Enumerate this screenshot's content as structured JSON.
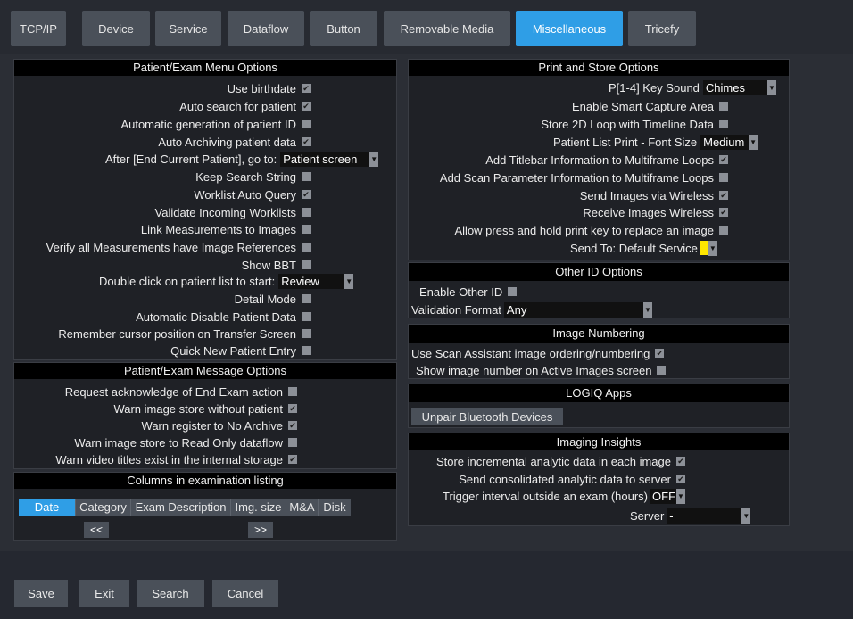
{
  "tabs": [
    "TCP/IP",
    "Device",
    "Service",
    "Dataflow",
    "Button",
    "Removable Media",
    "Miscellaneous",
    "Tricefy"
  ],
  "active_tab": "Miscellaneous",
  "patient_exam_menu": {
    "title": "Patient/Exam Menu Options",
    "use_birthdate": {
      "label": "Use birthdate",
      "checked": true
    },
    "auto_search": {
      "label": "Auto search for patient",
      "checked": true
    },
    "auto_gen_id": {
      "label": "Automatic generation of patient ID",
      "checked": false
    },
    "auto_archiving": {
      "label": "Auto Archiving patient data",
      "checked": true
    },
    "after_end": {
      "label": "After [End Current Patient], go to:",
      "value": "Patient screen"
    },
    "keep_search": {
      "label": "Keep Search String",
      "checked": false
    },
    "worklist_auto": {
      "label": "Worklist Auto Query",
      "checked": true
    },
    "validate_worklists": {
      "label": "Validate Incoming Worklists",
      "checked": false
    },
    "link_measurements": {
      "label": "Link Measurements to Images",
      "checked": false
    },
    "verify_measurements": {
      "label": "Verify all Measurements have Image References",
      "checked": false
    },
    "show_bbt": {
      "label": "Show BBT",
      "checked": false
    },
    "double_click": {
      "label": "Double click on patient list to start:",
      "value": "Review"
    },
    "detail_mode": {
      "label": "Detail Mode",
      "checked": false
    },
    "auto_disable": {
      "label": "Automatic Disable Patient Data",
      "checked": false
    },
    "remember_cursor": {
      "label": "Remember cursor position on Transfer Screen",
      "checked": false
    },
    "quick_new": {
      "label": "Quick New Patient Entry",
      "checked": false
    }
  },
  "patient_exam_message": {
    "title": "Patient/Exam Message Options",
    "request_ack": {
      "label": "Request acknowledge of End Exam action",
      "checked": false
    },
    "warn_store": {
      "label": "Warn image store without patient",
      "checked": true
    },
    "warn_register": {
      "label": "Warn register to No Archive",
      "checked": true
    },
    "warn_readonly": {
      "label": "Warn image store to Read Only dataflow",
      "checked": false
    },
    "warn_video": {
      "label": "Warn video titles exist in the internal storage",
      "checked": true
    }
  },
  "columns": {
    "title": "Columns in examination listing",
    "items": [
      "Date",
      "Category",
      "Exam Description",
      "Img. size",
      "M&A",
      "Disk"
    ],
    "prev": "<<",
    "next": ">>"
  },
  "print_store": {
    "title": "Print and Store Options",
    "key_sound": {
      "label": "P[1-4] Key Sound",
      "value": "Chimes"
    },
    "smart_capture": {
      "label": "Enable Smart Capture Area",
      "checked": false
    },
    "store_2d_loop": {
      "label": "Store 2D Loop with Timeline Data",
      "checked": false
    },
    "font_size": {
      "label": "Patient List Print - Font Size",
      "value": "Medium"
    },
    "titlebar_info": {
      "label": "Add Titlebar Information to Multiframe Loops",
      "checked": true
    },
    "scan_param": {
      "label": "Add Scan Parameter Information to Multiframe Loops",
      "checked": false
    },
    "send_wireless": {
      "label": "Send Images via Wireless",
      "checked": true
    },
    "receive_wireless": {
      "label": "Receive Images Wireless",
      "checked": true
    },
    "press_hold": {
      "label": "Allow press and hold print key to replace an image",
      "checked": false
    },
    "send_to": {
      "label": "Send To: Default Service"
    }
  },
  "other_id": {
    "title": "Other ID Options",
    "enable": {
      "label": "Enable Other ID",
      "checked": false
    },
    "validation": {
      "label": "Validation Format",
      "value": "Any"
    }
  },
  "image_numbering": {
    "title": "Image Numbering",
    "scan_assistant": {
      "label": "Use Scan Assistant image ordering/numbering",
      "checked": true
    },
    "show_number": {
      "label": "Show image number on Active Images screen",
      "checked": false
    }
  },
  "logiq_apps": {
    "title": "LOGIQ Apps",
    "unpair": "Unpair Bluetooth Devices"
  },
  "imaging_insights": {
    "title": "Imaging Insights",
    "store_incremental": {
      "label": "Store incremental analytic data in each image",
      "checked": true
    },
    "send_consolidated": {
      "label": "Send consolidated analytic data to server",
      "checked": true
    },
    "trigger": {
      "label": "Trigger interval outside an exam (hours)",
      "value": "OFF"
    },
    "server": {
      "label": "Server",
      "value": "-"
    }
  },
  "bottom_buttons": {
    "save": "Save",
    "exit": "Exit",
    "search": "Search",
    "cancel": "Cancel"
  },
  "colors": {
    "accent": "#2f9ee6",
    "panel": "#1f2126",
    "header": "#000000",
    "yellow": "#ffe600"
  }
}
